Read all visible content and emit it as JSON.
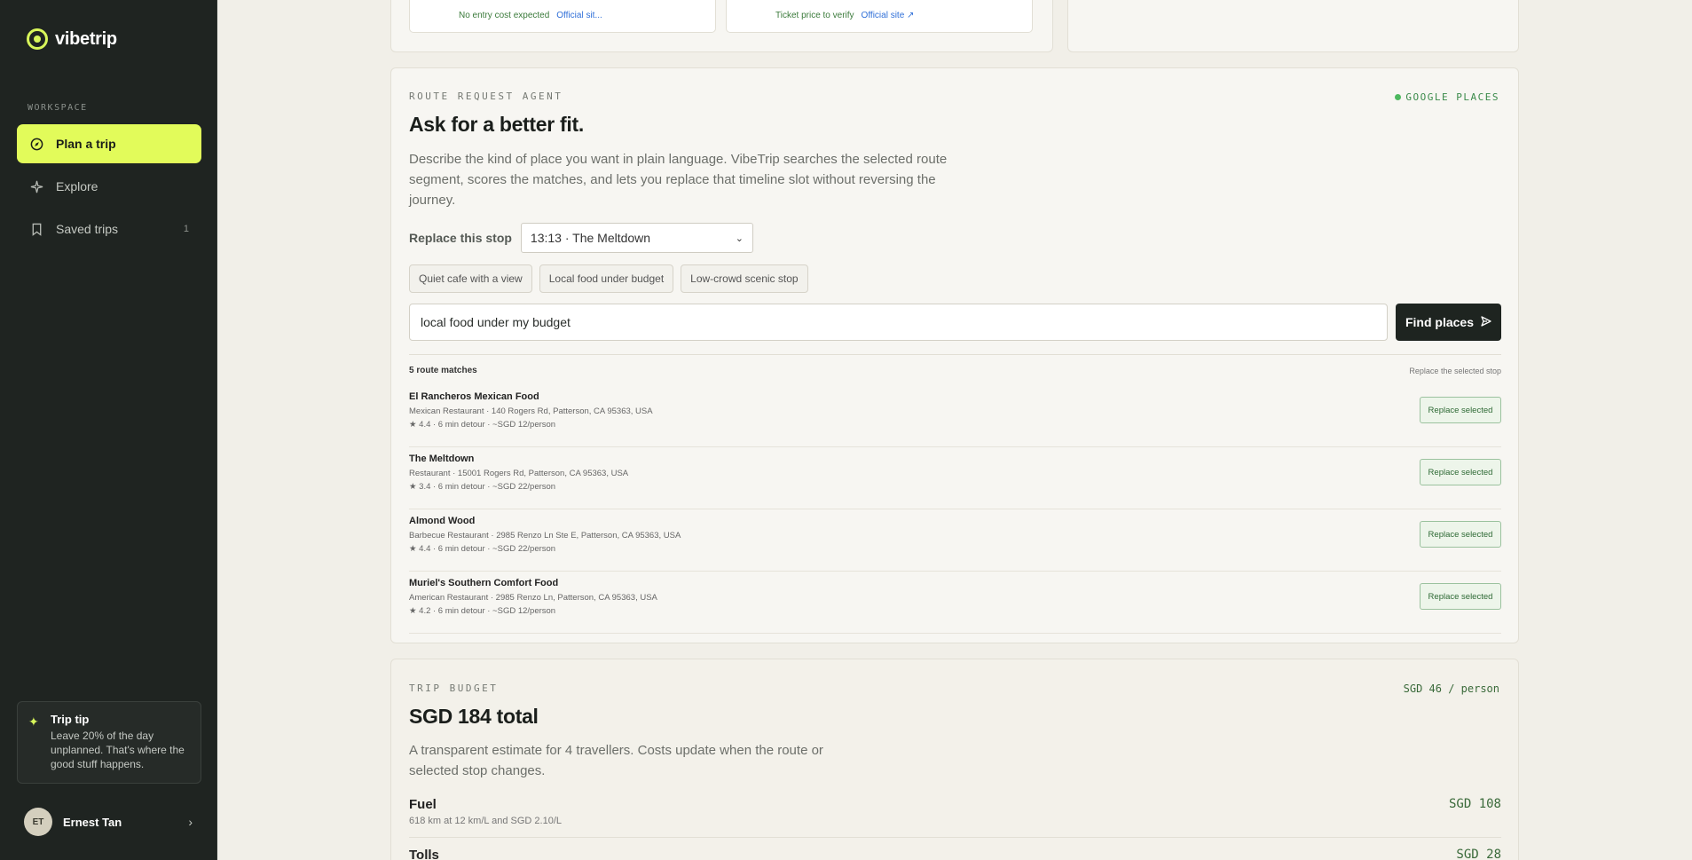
{
  "sidebar": {
    "brand": "vibetrip",
    "workspace_label": "WORKSPACE",
    "items": [
      {
        "label": "Plan a trip",
        "icon": "compass-icon"
      },
      {
        "label": "Explore",
        "icon": "sparkle-icon"
      },
      {
        "label": "Saved trips",
        "icon": "bookmark-icon",
        "count": "1"
      }
    ],
    "tip": {
      "title": "Trip tip",
      "body": "Leave 20% of the day unplanned. That's where the good stuff happens."
    },
    "user": {
      "initials": "ET",
      "name": "Ernest Tan"
    }
  },
  "top_cards": {
    "left": {
      "cost": "No entry cost expected",
      "link": "Official sit..."
    },
    "right": {
      "cost": "Ticket price to verify",
      "link": "Official site ↗"
    }
  },
  "agent": {
    "eyebrow": "ROUTE REQUEST AGENT",
    "badge": "GOOGLE PLACES",
    "title": "Ask for a better fit.",
    "description": "Describe the kind of place you want in plain language. VibeTrip searches the selected route segment, scores the matches, and lets you replace that timeline slot without reversing the journey.",
    "replace_label": "Replace this stop",
    "selected_stop": "13:13 · The Meltdown",
    "chips": [
      "Quiet cafe with a view",
      "Local food under budget",
      "Low-crowd scenic stop"
    ],
    "query": "local food under my budget",
    "find_label": "Find places",
    "match_count": "5 route matches",
    "match_hint": "Replace the selected stop",
    "replace_btn": "Replace selected",
    "results": [
      {
        "name": "El Rancheros Mexican Food",
        "address": "Mexican Restaurant · 140 Rogers Rd, Patterson, CA 95363, USA",
        "meta": "★ 4.4 · 6 min detour · ~SGD 12/person"
      },
      {
        "name": "The Meltdown",
        "address": "Restaurant · 15001 Rogers Rd, Patterson, CA 95363, USA",
        "meta": "★ 3.4 · 6 min detour · ~SGD 22/person"
      },
      {
        "name": "Almond Wood",
        "address": "Barbecue Restaurant · 2985 Renzo Ln Ste E, Patterson, CA 95363, USA",
        "meta": "★ 4.4 · 6 min detour · ~SGD 22/person"
      },
      {
        "name": "Muriel's Southern Comfort Food",
        "address": "American Restaurant · 2985 Renzo Ln, Patterson, CA 95363, USA",
        "meta": "★ 4.2 · 6 min detour · ~SGD 12/person"
      }
    ]
  },
  "budget": {
    "eyebrow": "TRIP BUDGET",
    "per_person": "SGD 46 / person",
    "total": "SGD 184 total",
    "description": "A transparent estimate for 4 travellers. Costs update when the route or selected stop changes.",
    "items": [
      {
        "title": "Fuel",
        "sub": "618 km at 12 km/L and SGD 2.10/L",
        "value": "SGD 108"
      },
      {
        "title": "Tolls",
        "sub": "",
        "value": "SGD 28"
      }
    ]
  }
}
